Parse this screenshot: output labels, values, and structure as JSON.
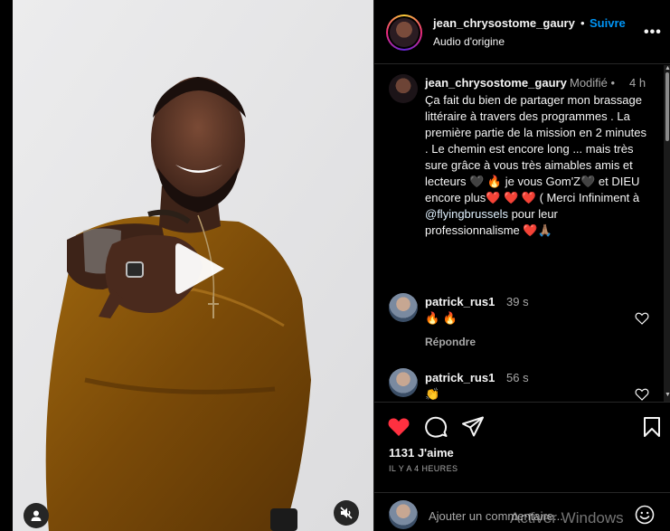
{
  "post": {
    "username": "jean_chrysostome_gaury",
    "dot": "•",
    "follow_label": "Suivre",
    "audio_label": "Audio d'origine",
    "more_label": "•••"
  },
  "caption": {
    "username": "jean_chrysostome_gaury",
    "edited_label": "Modifié",
    "edited_dot": "•",
    "time": "4 h",
    "line1": "Ça fait du bien de partager mon brassage littéraire à travers des programmes . La première partie de la mission en 2 minutes . Le chemin est encore long ... mais très sure grâce à vous très aimables amis et lecteurs 🖤 🔥 je vous Gom'Z🖤 et DIEU encore plus❤️ ❤️ ❤️ ( Merci Infiniment à ",
    "mention": "@flyingbrussels",
    "line2": " pour leur professionnalisme ❤️🙏🏽"
  },
  "comments": [
    {
      "username": "patrick_rus1",
      "time": "39 s",
      "text": "🔥 🔥",
      "reply_label": "Répondre"
    },
    {
      "username": "patrick_rus1",
      "time": "56 s",
      "text": "👏"
    }
  ],
  "actions": {
    "likes": "1131 J'aime",
    "posted_ago": "IL Y A 4 HEURES",
    "like_color": "#ff3040"
  },
  "add_comment": {
    "placeholder": "Ajouter un commentaire...",
    "watermark": "Activer Windows"
  },
  "icons": {
    "play": "play-icon",
    "user_tag": "user-tag-icon",
    "mute": "speaker-muted-icon",
    "like": "heart-icon",
    "comment": "comment-bubble-icon",
    "share": "paper-plane-icon",
    "save": "bookmark-icon",
    "emoji": "emoji-smile-icon"
  }
}
